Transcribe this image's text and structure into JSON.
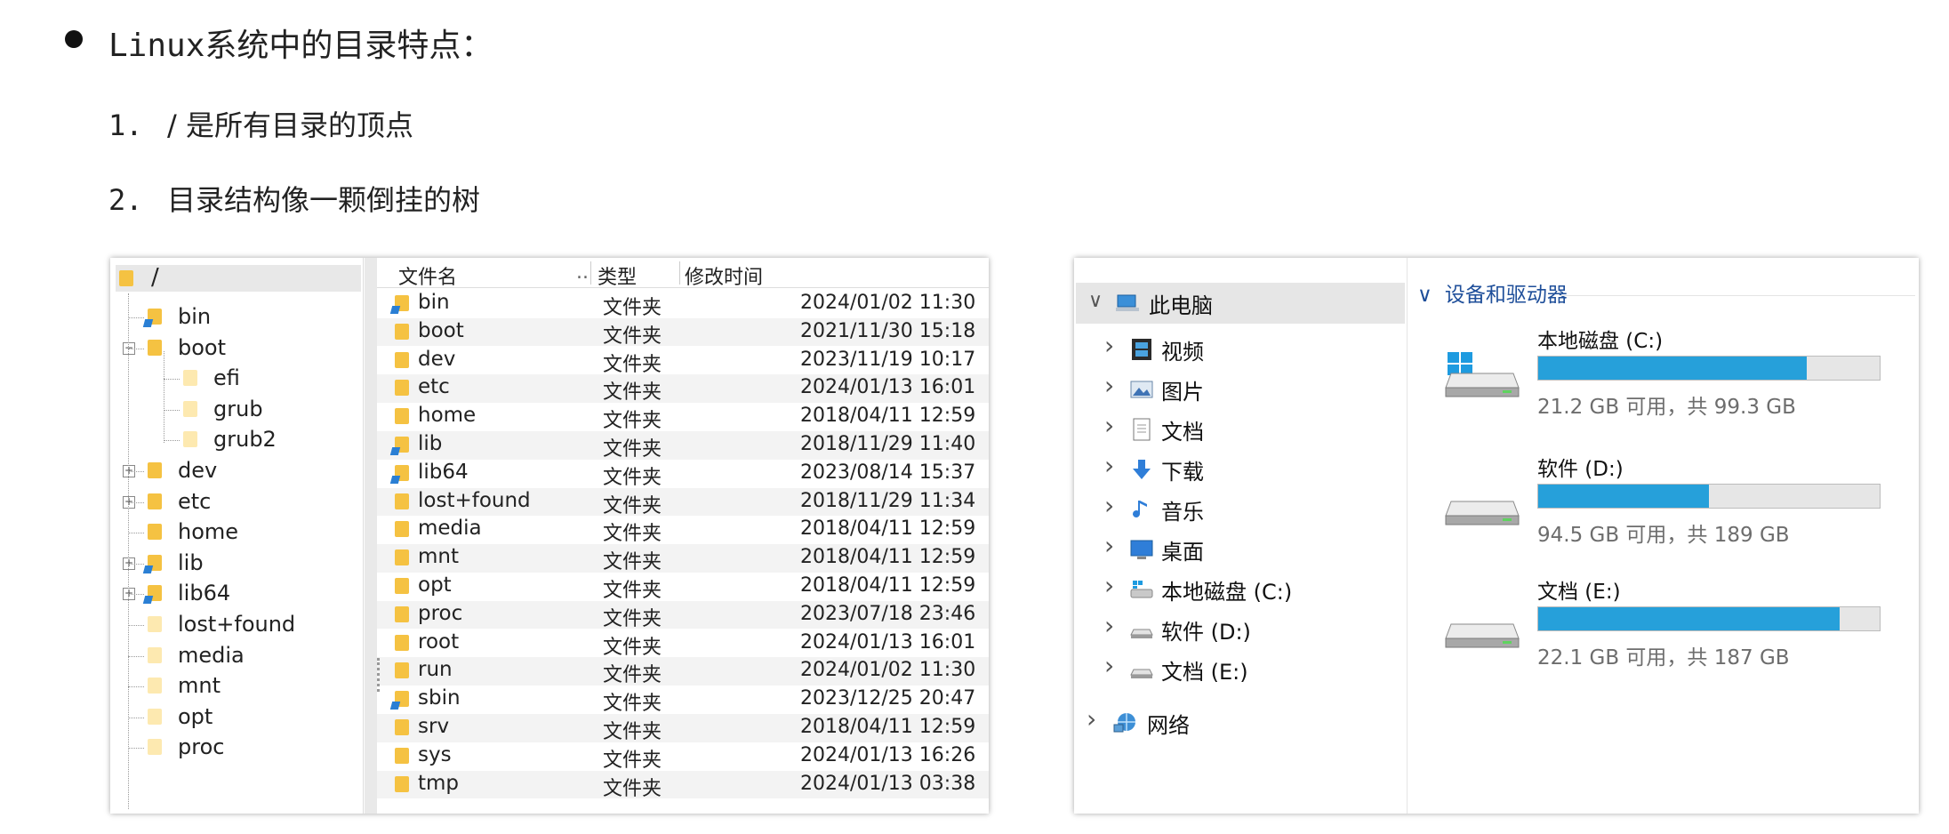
{
  "slide": {
    "heading": "Linux系统中的目录特点：",
    "points": [
      {
        "num": "1.",
        "text": "/ 是所有目录的顶点"
      },
      {
        "num": "2.",
        "text": "目录结构像一颗倒挂的树"
      }
    ]
  },
  "tree": {
    "root": "/",
    "items": [
      {
        "label": "bin",
        "level": 1,
        "link": true,
        "toggle": ""
      },
      {
        "label": "boot",
        "level": 1,
        "link": false,
        "toggle": "−"
      },
      {
        "label": "efi",
        "level": 2,
        "link": false,
        "toggle": ""
      },
      {
        "label": "grub",
        "level": 2,
        "link": false,
        "toggle": ""
      },
      {
        "label": "grub2",
        "level": 2,
        "link": false,
        "toggle": ""
      },
      {
        "label": "dev",
        "level": 1,
        "link": false,
        "toggle": "+"
      },
      {
        "label": "etc",
        "level": 1,
        "link": false,
        "toggle": "+"
      },
      {
        "label": "home",
        "level": 1,
        "link": false,
        "toggle": ""
      },
      {
        "label": "lib",
        "level": 1,
        "link": true,
        "toggle": "+"
      },
      {
        "label": "lib64",
        "level": 1,
        "link": true,
        "toggle": "+"
      },
      {
        "label": "lost+found",
        "level": 1,
        "link": false,
        "toggle": ""
      },
      {
        "label": "media",
        "level": 1,
        "link": false,
        "toggle": ""
      },
      {
        "label": "mnt",
        "level": 1,
        "link": false,
        "toggle": ""
      },
      {
        "label": "opt",
        "level": 1,
        "link": false,
        "toggle": ""
      },
      {
        "label": "proc",
        "level": 1,
        "link": false,
        "toggle": ""
      }
    ]
  },
  "file_list": {
    "headers": {
      "name": "文件名",
      "type": "类型",
      "modified": "修改时间"
    },
    "rows": [
      {
        "name": "bin",
        "type": "文件夹",
        "date": "2024/01/02 11:30",
        "link": true
      },
      {
        "name": "boot",
        "type": "文件夹",
        "date": "2021/11/30 15:18",
        "link": false
      },
      {
        "name": "dev",
        "type": "文件夹",
        "date": "2023/11/19 10:17",
        "link": false
      },
      {
        "name": "etc",
        "type": "文件夹",
        "date": "2024/01/13 16:01",
        "link": false
      },
      {
        "name": "home",
        "type": "文件夹",
        "date": "2018/04/11 12:59",
        "link": false
      },
      {
        "name": "lib",
        "type": "文件夹",
        "date": "2018/11/29 11:40",
        "link": true
      },
      {
        "name": "lib64",
        "type": "文件夹",
        "date": "2023/08/14 15:37",
        "link": true
      },
      {
        "name": "lost+found",
        "type": "文件夹",
        "date": "2018/11/29 11:34",
        "link": false
      },
      {
        "name": "media",
        "type": "文件夹",
        "date": "2018/04/11 12:59",
        "link": false
      },
      {
        "name": "mnt",
        "type": "文件夹",
        "date": "2018/04/11 12:59",
        "link": false
      },
      {
        "name": "opt",
        "type": "文件夹",
        "date": "2018/04/11 12:59",
        "link": false
      },
      {
        "name": "proc",
        "type": "文件夹",
        "date": "2023/07/18 23:46",
        "link": false
      },
      {
        "name": "root",
        "type": "文件夹",
        "date": "2024/01/13 16:01",
        "link": false
      },
      {
        "name": "run",
        "type": "文件夹",
        "date": "2024/01/02 11:30",
        "link": false
      },
      {
        "name": "sbin",
        "type": "文件夹",
        "date": "2023/12/25 20:47",
        "link": true
      },
      {
        "name": "srv",
        "type": "文件夹",
        "date": "2018/04/11 12:59",
        "link": false
      },
      {
        "name": "sys",
        "type": "文件夹",
        "date": "2024/01/13 16:26",
        "link": false
      },
      {
        "name": "tmp",
        "type": "文件夹",
        "date": "2024/01/13 03:38",
        "link": false
      }
    ]
  },
  "explorer": {
    "nav": [
      {
        "label": "此电脑",
        "icon": "computer-icon",
        "expanded": true,
        "selected": true
      },
      {
        "label": "视频",
        "icon": "video-icon",
        "expanded": false,
        "selected": false
      },
      {
        "label": "图片",
        "icon": "pictures-icon",
        "expanded": false,
        "selected": false
      },
      {
        "label": "文档",
        "icon": "documents-icon",
        "expanded": false,
        "selected": false
      },
      {
        "label": "下载",
        "icon": "download-icon",
        "expanded": false,
        "selected": false
      },
      {
        "label": "音乐",
        "icon": "music-icon",
        "expanded": false,
        "selected": false
      },
      {
        "label": "桌面",
        "icon": "desktop-icon",
        "expanded": false,
        "selected": false
      },
      {
        "label": "本地磁盘 (C:)",
        "icon": "windows-drive-icon",
        "expanded": false,
        "selected": false
      },
      {
        "label": "软件 (D:)",
        "icon": "drive-icon",
        "expanded": false,
        "selected": false
      },
      {
        "label": "文档 (E:)",
        "icon": "drive-icon",
        "expanded": false,
        "selected": false
      },
      {
        "label": "网络",
        "icon": "network-icon",
        "expanded": false,
        "selected": false
      }
    ],
    "section_title": "设备和驱动器",
    "drives": [
      {
        "name": "本地磁盘 (C:)",
        "size_text": "21.2 GB 可用，共 99.3 GB",
        "used_fraction": 0.786,
        "windows": true
      },
      {
        "name": "软件 (D:)",
        "size_text": "94.5 GB 可用，共 189 GB",
        "used_fraction": 0.5,
        "windows": false
      },
      {
        "name": "文档 (E:)",
        "size_text": "22.1 GB 可用，共 187 GB",
        "used_fraction": 0.882,
        "windows": false
      }
    ],
    "colors": {
      "bar_fill": "#26a0da",
      "section_title": "#1f4f9a"
    }
  }
}
